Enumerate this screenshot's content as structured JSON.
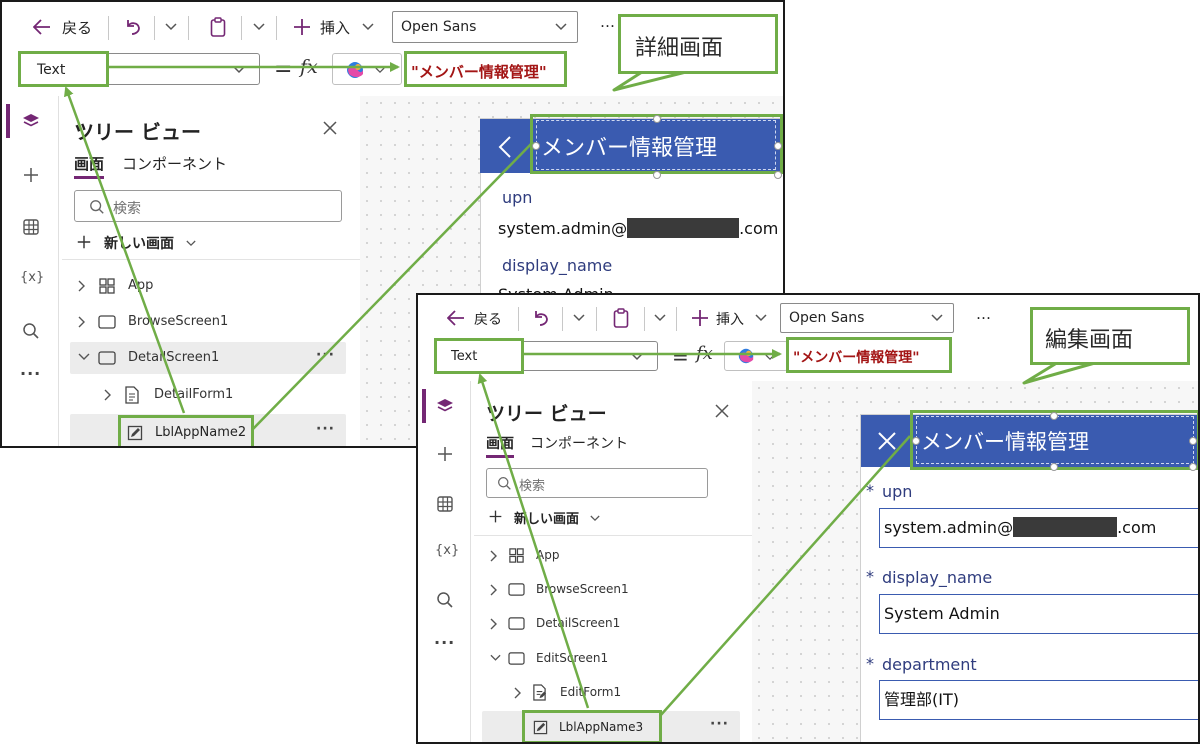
{
  "toolbar": {
    "back_label": "戻る",
    "insert_label": "挿入",
    "font_value": "Open Sans",
    "more": "…"
  },
  "formula_bar": {
    "property_value": "Text",
    "equals": "=",
    "fx": "fx"
  },
  "tree_view": {
    "title": "ツリー ビュー",
    "tab_screens": "画面",
    "tab_components": "コンポーネント",
    "search_placeholder": "検索",
    "new_screen_label": "新しい画面"
  },
  "rail": {
    "variables_label": "{x}"
  },
  "detail_panel": {
    "callout": "詳細画面",
    "formula_value": "\"メンバー情報管理\"",
    "header_title": "メンバー情報管理",
    "tree_items": [
      "App",
      "BrowseScreen1",
      "DetailScreen1",
      "DetailForm1",
      "LblAppName2"
    ],
    "fields": [
      {
        "label": "upn",
        "value_prefix": "system.admin@",
        "value_suffix": ".com"
      },
      {
        "label": "display_name",
        "value": "System Admin"
      }
    ]
  },
  "edit_panel": {
    "callout": "編集画面",
    "formula_value": "\"メンバー情報管理\"",
    "header_title": "メンバー情報管理",
    "tree_items": [
      "App",
      "BrowseScreen1",
      "DetailScreen1",
      "EditScreen1",
      "EditForm1",
      "LblAppName3"
    ],
    "required_mark": "*",
    "fields": [
      {
        "label": "upn",
        "value_prefix": "system.admin@",
        "value_suffix": ".com"
      },
      {
        "label": "display_name",
        "value": "System Admin"
      },
      {
        "label": "department",
        "value": "管理部(IT)"
      }
    ]
  },
  "colors": {
    "accent_green": "#70ad47",
    "header_blue": "#3a5bb0",
    "formula_red": "#a31515",
    "brand_purple": "#742774"
  }
}
